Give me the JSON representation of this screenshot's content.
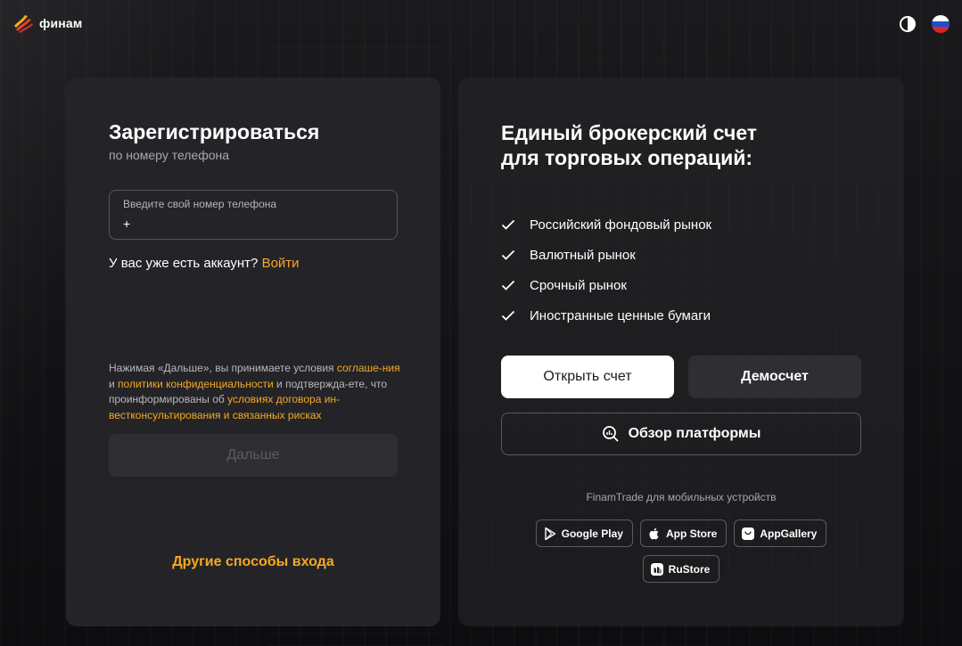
{
  "header": {
    "logo_text": "финам",
    "theme_icon": "contrast-icon",
    "language_icon": "russia-flag-icon",
    "flag_colors": [
      "#ffffff",
      "#1f4fc9",
      "#d6282b"
    ]
  },
  "colors": {
    "accent": "#f7a823",
    "card_bg": "#242428",
    "page_bg": "#101012"
  },
  "register": {
    "title": "Зарегистрироваться",
    "subtitle": "по номеру телефона",
    "phone_label": "Введите свой номер телефона",
    "phone_value": "+",
    "has_account_text": "У вас уже есть аккаунт?",
    "login_link": "Войти",
    "terms": {
      "part1": "Нажимая «Дальше», вы принимаете условия ",
      "link1": "соглаше-ния",
      "part2": " и ",
      "link2": "политики конфиденциальности",
      "part3": " и подтвержда-ете, что проинформированы об ",
      "link3": "условиях договора ин-вестконсультирования и связанных рисках"
    },
    "next_button": "Дальше",
    "other_ways": "Другие способы входа"
  },
  "promo": {
    "title_line1": "Единый брокерский счет",
    "title_line2": "для торговых операций:",
    "features": [
      "Российский фондовый рынок",
      "Валютный рынок",
      "Срочный рынок",
      "Иностранные ценные бумаги"
    ],
    "open_account_button": "Открыть счет",
    "demo_button": "Демосчет",
    "overview_button": "Обзор платформы",
    "mobile_caption": "FinamTrade для мобильных устройств",
    "stores": [
      {
        "label": "Google Play",
        "icon": "google-play-icon"
      },
      {
        "label": "App Store",
        "icon": "apple-icon"
      },
      {
        "label": "AppGallery",
        "icon": "appgallery-icon"
      },
      {
        "label": "RuStore",
        "icon": "rustore-icon"
      }
    ]
  }
}
